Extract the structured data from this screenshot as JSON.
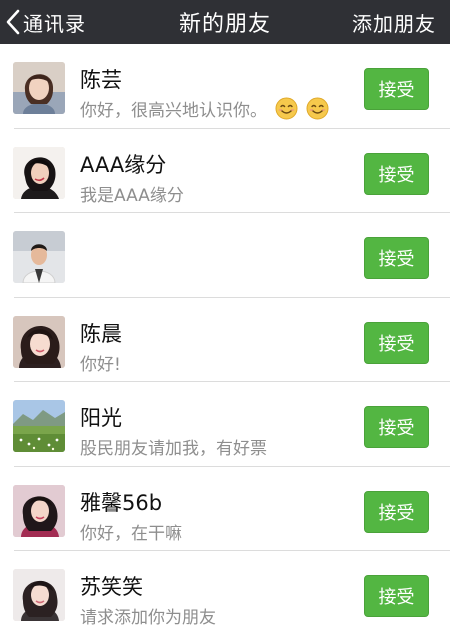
{
  "nav": {
    "back_label": "通讯录",
    "title": "新的朋友",
    "action_label": "添加朋友"
  },
  "colors": {
    "nav_bg": "#2f3035",
    "accept_green": "#53b642"
  },
  "requests": [
    {
      "name": "陈芸",
      "message": "你好，很高兴地认识你。",
      "emoji_count": 2,
      "button": "接受"
    },
    {
      "name": "AAA缘分",
      "message": "我是AAA缘分",
      "emoji_count": 0,
      "button": "接受"
    },
    {
      "name": "",
      "message": "",
      "emoji_count": 0,
      "button": "接受"
    },
    {
      "name": "陈晨",
      "message": "你好!",
      "emoji_count": 0,
      "button": "接受"
    },
    {
      "name": "阳光",
      "message": "股民朋友请加我，有好票",
      "emoji_count": 0,
      "button": "接受"
    },
    {
      "name": "雅馨56b",
      "message": "你好，在干嘛",
      "emoji_count": 0,
      "button": "接受"
    },
    {
      "name": "苏笑笑",
      "message": "请求添加你为朋友",
      "emoji_count": 0,
      "button": "接受"
    }
  ],
  "icons": {
    "back": "chevron-left-icon",
    "emoji": "smiley-emoji-icon"
  }
}
